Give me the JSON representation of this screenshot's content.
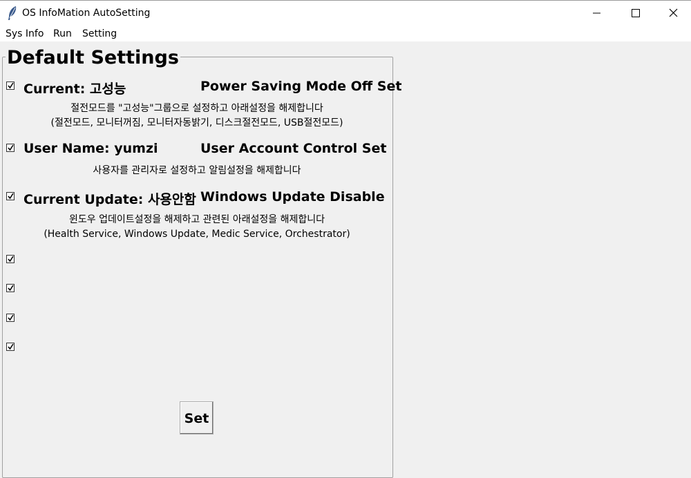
{
  "window": {
    "title": "OS InfoMation AutoSetting"
  },
  "menu": [
    "Sys Info",
    "Run",
    "Setting"
  ],
  "group": {
    "title": "Default Settings",
    "rows": [
      {
        "checked": true,
        "label": "Current: 고성능",
        "action": "Power Saving Mode Off Set",
        "desc1": "절전모드를 \"고성능\"그룹으로 설정하고 아래설정을 해제합니다",
        "desc2": "(절전모드, 모니터꺼짐, 모니터자동밝기, 디스크절전모드, USB절전모드)"
      },
      {
        "checked": true,
        "label": "User Name: yumzi",
        "action": "User Account Control Set",
        "desc1": "사용자를 관리자로 설정하고 알림설정을 해제합니다"
      },
      {
        "checked": true,
        "label": "Current Update: 사용안함",
        "action": "Windows Update Disable",
        "desc1": "윈도우 업데이트설정을 해제하고 관련된 아래설정을 해제합니다",
        "desc2": "(Health Service, Windows Update, Medic Service, Orchestrator)"
      }
    ],
    "extra_checkboxes": [
      true,
      true,
      true,
      true
    ],
    "set_button": "Set"
  }
}
